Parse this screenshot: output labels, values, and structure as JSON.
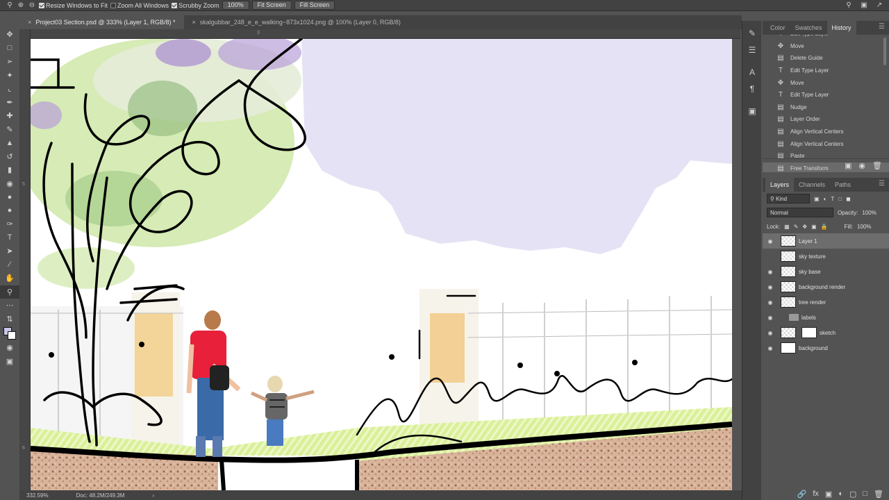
{
  "options_bar": {
    "resize_windows": "Resize Windows to Fit",
    "zoom_all": "Zoom All Windows",
    "scrubby": "Scrubby Zoom",
    "zoom_value": "100%",
    "fit_screen": "Fit Screen",
    "fill_screen": "Fill Screen"
  },
  "tabs": [
    {
      "label": "Project03 Section.psd @ 333% (Layer 1, RGB/8) *"
    },
    {
      "label": "skalgubbar_248_e_e_walking~873x1024.png @ 100% (Layer 0, RGB/8)"
    }
  ],
  "ruler": {
    "h_tick": "3",
    "v_tick_1": "5",
    "v_tick_2": "6"
  },
  "status": {
    "zoom": "332.59%",
    "doc": "Doc: 48.2M/249.3M"
  },
  "panel_tabs_top": {
    "color": "Color",
    "swatches": "Swatches",
    "history": "History"
  },
  "history_items": [
    {
      "label": "Edit Type Layer",
      "icon": "type-icon"
    },
    {
      "label": "Move",
      "icon": "move-icon"
    },
    {
      "label": "Delete Guide",
      "icon": "doc-icon"
    },
    {
      "label": "Edit Type Layer",
      "icon": "type-icon"
    },
    {
      "label": "Move",
      "icon": "move-icon"
    },
    {
      "label": "Edit Type Layer",
      "icon": "type-icon"
    },
    {
      "label": "Nudge",
      "icon": "doc-icon"
    },
    {
      "label": "Layer Order",
      "icon": "doc-icon"
    },
    {
      "label": "Align Vertical Centers",
      "icon": "doc-icon"
    },
    {
      "label": "Align Vertical Centers",
      "icon": "doc-icon"
    },
    {
      "label": "Paste",
      "icon": "doc-icon"
    },
    {
      "label": "Free Transform",
      "icon": "doc-icon"
    }
  ],
  "panel_tabs_bottom": {
    "layers": "Layers",
    "channels": "Channels",
    "paths": "Paths"
  },
  "layers_controls": {
    "kind": "Kind",
    "blend": "Normal",
    "opacity_label": "Opacity:",
    "opacity": "100%",
    "lock_label": "Lock:",
    "fill_label": "Fill:",
    "fill": "100%"
  },
  "layers": [
    {
      "name": "Layer 1",
      "visible": true,
      "selected": true
    },
    {
      "name": "sky texture",
      "visible": false
    },
    {
      "name": "sky base",
      "visible": true
    },
    {
      "name": "background render",
      "visible": true
    },
    {
      "name": "tree render",
      "visible": true
    },
    {
      "name": "labels",
      "visible": true,
      "group": true
    },
    {
      "name": "sketch",
      "visible": true,
      "mask": true
    },
    {
      "name": "background",
      "visible": true
    }
  ],
  "colors": {
    "foreground": "#c8c6e8",
    "background": "#ffffff",
    "shirt": "#e8203a",
    "sky": "#e4e2f4"
  }
}
